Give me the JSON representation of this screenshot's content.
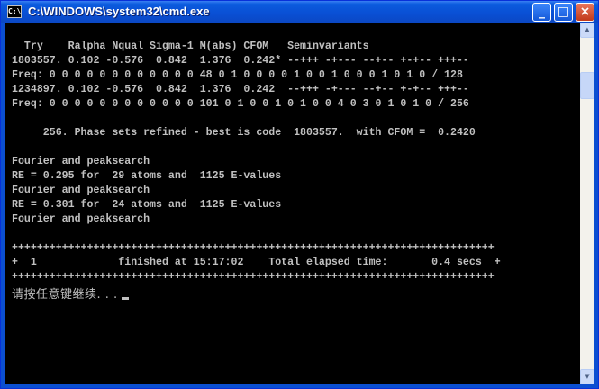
{
  "window": {
    "title": "C:\\WINDOWS\\system32\\cmd.exe",
    "icon_label": "C:\\",
    "minimize_symbol": "_",
    "maximize_symbol": "□",
    "close_symbol": "×"
  },
  "console": {
    "lines": [
      "  Try    Ralpha Nqual Sigma-1 M(abs) CFOM   Seminvariants",
      "1803557. 0.102 -0.576  0.842  1.376  0.242* --+++ -+--- --+-- +-+-- +++--",
      "Freq: 0 0 0 0 0 0 0 0 0 0 0 0 48 0 1 0 0 0 0 1 0 0 1 0 0 0 1 0 1 0 / 128",
      "1234897. 0.102 -0.576  0.842  1.376  0.242  --+++ -+--- --+-- +-+-- +++--",
      "Freq: 0 0 0 0 0 0 0 0 0 0 0 0 101 0 1 0 0 1 0 1 0 0 4 0 3 0 1 0 1 0 / 256",
      "",
      "     256. Phase sets refined - best is code  1803557.  with CFOM =  0.2420",
      "",
      "Fourier and peaksearch",
      "RE = 0.295 for  29 atoms and  1125 E-values",
      "Fourier and peaksearch",
      "RE = 0.301 for  24 atoms and  1125 E-values",
      "Fourier and peaksearch",
      "",
      "+++++++++++++++++++++++++++++++++++++++++++++++++++++++++++++++++++++++++++++",
      "+  1             finished at 15:17:02    Total elapsed time:       0.4 secs  +",
      "+++++++++++++++++++++++++++++++++++++++++++++++++++++++++++++++++++++++++++++"
    ],
    "prompt": "请按任意键继续. . ."
  },
  "colors": {
    "titlebar": "#0b5bde",
    "console_bg": "#000000",
    "console_fg": "#c0c0c0",
    "close_button": "#c1391a"
  }
}
